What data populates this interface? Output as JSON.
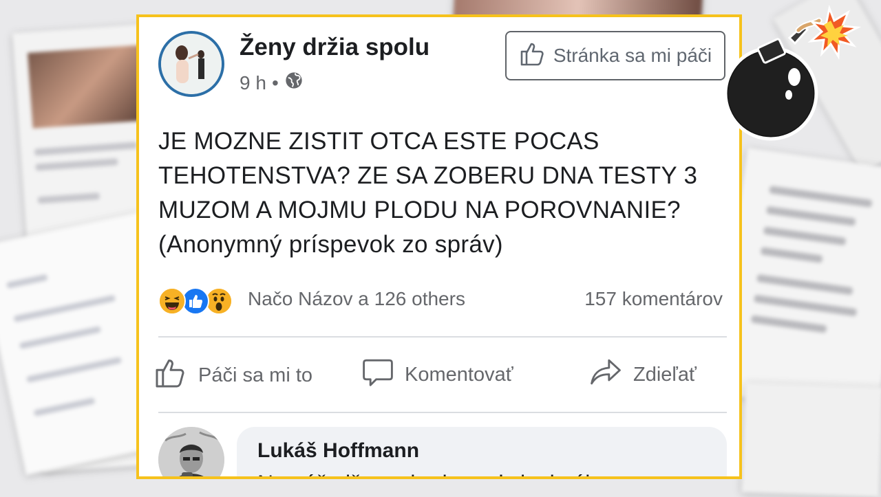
{
  "post": {
    "page_name": "Ženy držia spolu",
    "time": "9 h",
    "separator": "•",
    "like_page_label": "Stránka sa mi páči",
    "text_lines": [
      "JE MOZNE ZISTIT OTCA ESTE POCAS",
      "TEHOTENSTVA? ZE SA ZOBERU DNA TESTY 3",
      "MUZOM A MOJMU PLODU NA POROVNANIE?",
      "(Anonymný príspevok zo správ)"
    ],
    "reactions_text": "Načo Názov a 126 others",
    "comments_count": "157 komentárov",
    "actions": {
      "like": "Páči sa mi to",
      "comment": "Komentovať",
      "share": "Zdieľať"
    },
    "icons": [
      "globe-icon",
      "thumbs-up-icon",
      "comment-icon",
      "share-icon",
      "haha-reaction-icon",
      "like-reaction-icon",
      "wow-reaction-icon"
    ]
  },
  "comment": {
    "author": "Lukáš Hoffmann",
    "text_partial": "Nemáš nižu rozhodzovať ako letáky z"
  },
  "colors": {
    "frame": "#f6c21c",
    "like_blue": "#1877f2",
    "text": "#1c1e21",
    "muted": "#65676b"
  }
}
